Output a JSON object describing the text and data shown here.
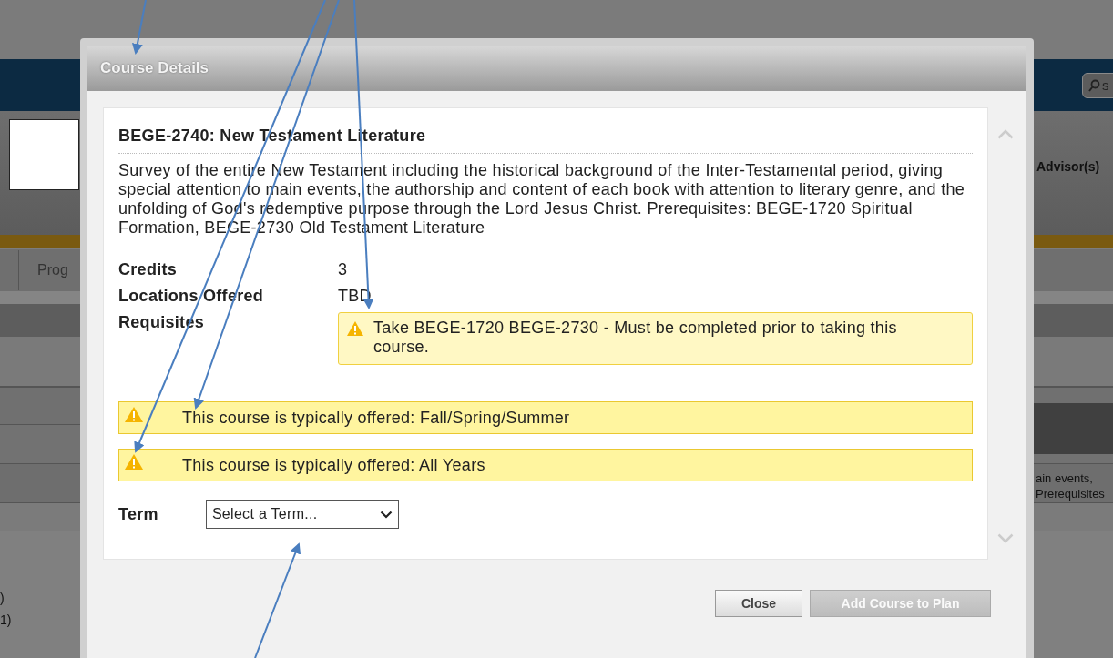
{
  "background": {
    "search_text": "s",
    "advisor_label": "Advisor(s)",
    "tab_label": "Prog",
    "description_fragments": [
      "ain events,",
      "Prerequisites"
    ],
    "list_fragments": [
      ")",
      "1)"
    ]
  },
  "dialog": {
    "title": "Course Details",
    "course_title": "BEGE-2740: New Testament Literature",
    "description": "Survey of the entire New Testament including the historical background of the Inter-Testamental period, giving special attention to main events, the authorship and content of each book with attention to literary genre, and the unfolding of God's redemptive purpose through the Lord Jesus Christ. Prerequisites: BEGE-1720 Spiritual Formation, BEGE-2730 Old Testament Literature",
    "details": [
      {
        "label": "Credits",
        "value": "3"
      },
      {
        "label": "Locations Offered",
        "value": "TBD"
      }
    ],
    "requisites": {
      "label": "Requisites",
      "notice": "Take BEGE-1720 BEGE-2730 - Must be completed prior to taking this course."
    },
    "offering_notices": [
      "This course is typically offered: Fall/Spring/Summer",
      "This course is typically offered: All Years"
    ],
    "term": {
      "label": "Term",
      "placeholder": "Select a Term..."
    },
    "buttons": [
      {
        "label": "Close",
        "disabled": false
      },
      {
        "label": "Add Course to Plan",
        "disabled": true
      }
    ]
  }
}
